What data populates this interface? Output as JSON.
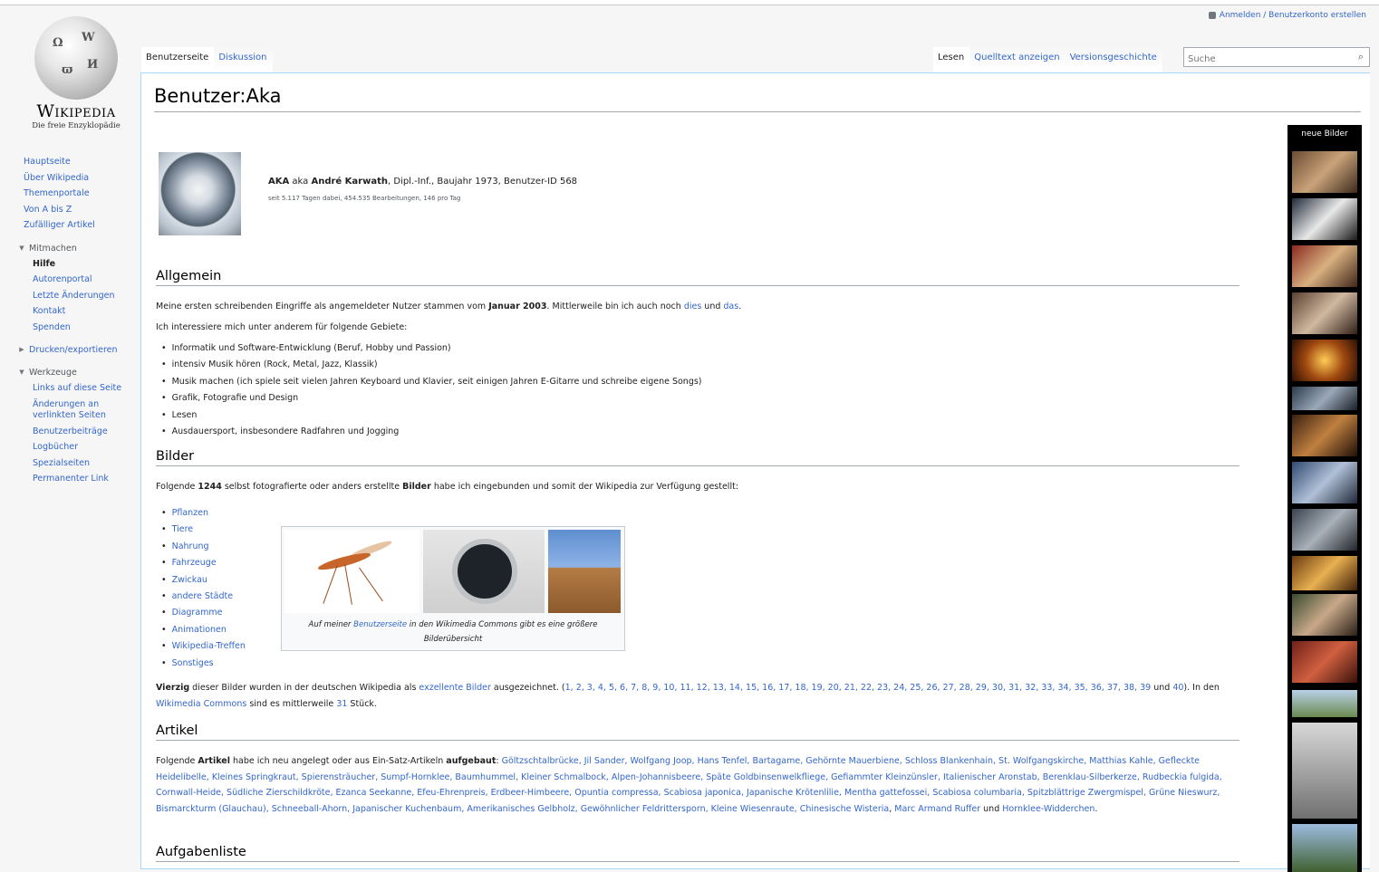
{
  "personal_tools": {
    "label": "Anmelden / Benutzerkonto erstellen"
  },
  "logo": {
    "wordmark": "Wikipedia",
    "tagline": "Die freie Enzyklopädie"
  },
  "sidebar": {
    "main_items": [
      {
        "label": "Hauptseite"
      },
      {
        "label": "Über Wikipedia"
      },
      {
        "label": "Themenportale"
      },
      {
        "label": "Von A bis Z"
      },
      {
        "label": "Zufälliger Artikel"
      }
    ],
    "groups": [
      {
        "title": "Mitmachen",
        "items": [
          {
            "label": "Hilfe"
          },
          {
            "label": "Autorenportal"
          },
          {
            "label": "Letzte Änderungen"
          },
          {
            "label": "Kontakt"
          },
          {
            "label": "Spenden"
          }
        ]
      },
      {
        "title": "Drucken/exportieren",
        "items": []
      },
      {
        "title": "Werkzeuge",
        "items": [
          {
            "label": "Links auf diese Seite"
          },
          {
            "label": "Änderungen an verlinkten Seiten"
          },
          {
            "label": "Benutzerbeiträge"
          },
          {
            "label": "Logbücher"
          },
          {
            "label": "Spezialseiten"
          },
          {
            "label": "Permanenter Link"
          }
        ]
      }
    ]
  },
  "tabs": {
    "left": [
      {
        "label": "Benutzerseite"
      },
      {
        "label": "Diskussion"
      }
    ],
    "right": [
      {
        "label": "Lesen"
      },
      {
        "label": "Quelltext anzeigen"
      },
      {
        "label": "Versionsgeschichte"
      }
    ]
  },
  "search": {
    "placeholder": "Suche"
  },
  "page": {
    "title": "Benutzer:Aka",
    "intro": {
      "prefix": "AKA",
      "mid1": " aka ",
      "name": "André Karwath",
      "rest": ", Dipl.-Inf., Baujahr 1973, Benutzer-ID 568",
      "stats": "seit 5.117 Tagen dabei, 454.535 Bearbeitungen, 146 pro Tag"
    },
    "allgemein": {
      "heading": "Allgemein",
      "p1_a": "Meine ersten schreibenden Eingriffe als angemeldeter Nutzer stammen vom ",
      "p1_bold": "Januar 2003",
      "p1_b": ". Mittlerweile bin ich auch noch ",
      "p1_link1": "dies",
      "p1_c": " und ",
      "p1_link2": "das",
      "p1_d": ".",
      "p2": "Ich interessiere mich unter anderem für folgende Gebiete:",
      "interests": [
        "Informatik und Software-Entwicklung (Beruf, Hobby und Passion)",
        "intensiv Musik hören (Rock, Metal, Jazz, Klassik)",
        "Musik machen (ich spiele seit vielen Jahren Keyboard und Klavier, seit einigen Jahren E-Gitarre und schreibe eigene Songs)",
        "Grafik, Fotografie und Design",
        "Lesen",
        "Ausdauersport, insbesondere Radfahren und Jogging"
      ]
    },
    "bilder": {
      "heading": "Bilder",
      "p_a": "Folgende ",
      "p_bold1": "1244",
      "p_b": " selbst fotografierte oder anders erstellte ",
      "p_bold2": "Bilder",
      "p_c": " habe ich eingebunden und somit der Wikipedia zur Verfügung gestellt:",
      "categories": [
        "Pflanzen",
        "Tiere",
        "Nahrung",
        "Fahrzeuge",
        "Zwickau",
        "andere Städte",
        "Diagramme",
        "Animationen",
        "Wikipedia-Treffen",
        "Sonstiges"
      ],
      "caption_a": "Auf meiner ",
      "caption_link": "Benutzerseite",
      "caption_b": " in den Wikimedia Commons gibt es eine größere Bilderübersicht",
      "excellent_bold": "Vierzig",
      "excellent_a": " dieser Bilder wurden in der deutschen Wikipedia als ",
      "excellent_link": "exzellente Bilder",
      "excellent_b": " ausgezeichnet. (",
      "excellent_numbers": "1, 2, 3, 4, 5, 6, 7, 8, 9, 10, 11, 12, 13, 14, 15, 16, 17, 18, 19, 20, 21, 22, 23, 24, 25, 26, 27, 28, 29, 30, 31, 32, 33, 34, 35, 36, 37, 38,",
      "excellent_numbers2": "39",
      "excellent_c": " und ",
      "excellent_numbers3": "40",
      "excellent_d": "). In den ",
      "excellent_link2": "Wikimedia Commons",
      "excellent_e": " sind es mittlerweile ",
      "excellent_link3": "31",
      "excellent_f": " Stück."
    },
    "artikel": {
      "heading": "Artikel",
      "p_a": "Folgende ",
      "p_bold1": "Artikel",
      "p_b": " habe ich neu angelegt oder aus Ein-Satz-Artikeln ",
      "p_bold2": "aufgebaut",
      "p_c": ": ",
      "line1": "Göltzschtalbrücke, Jil Sander, Wolfgang Joop, Hans Tenfel, Bartagame, Gehörnte Mauerbiene, Schloss Blankenhain, St. Wolfgangskirche, Matthias",
      "line2": "Kahle, Gefleckte Heidelibelle, Kleines Springkraut, Spierensträucher, Sumpf-Hornklee, Baumhummel, Kleiner Schmalbock, Alpen-Johannisbeere, Späte Goldbinsenwelkfliege, Gefiammter Kleinzünsler, Italienischer Aronstab,",
      "line3": "Berenklau-Silberkerze, Rudbeckia fulgida, Cornwall-Heide, Südliche Zierschildkröte, Ezanca Seekanne, Efeu-Ehrenpreis, Erdbeer-Himbeere, Opuntia compressa, Scabiosa japonica, Japanische Krötenlilie, Mentha gattefossei,",
      "line4": "Scabiosa columbaria, Spitzblättrige Zwergmispel, Grüne Nieswurz, Bismarckturm (Glauchau), Schneeball-Ahorn, Japanischer Kuchenbaum, Amerikanisches Gelbholz, Gewöhnlicher Feldrittersporn, Kleine Wiesenraute,",
      "line5_link1": "Chinesische Wisteria",
      "line5_a": ", ",
      "line5_link2": "Marc Armand Ruffer",
      "line5_b": " und ",
      "line5_link3": "Hornklee-Widderchen",
      "line5_c": "."
    },
    "aufgaben": {
      "heading": "Aufgabenliste"
    }
  },
  "strip": {
    "title": "neue Bilder"
  },
  "colors": {
    "link": "#3366cc",
    "border": "#a7d7f9",
    "sidebar_bg": "#f6f6f6"
  }
}
